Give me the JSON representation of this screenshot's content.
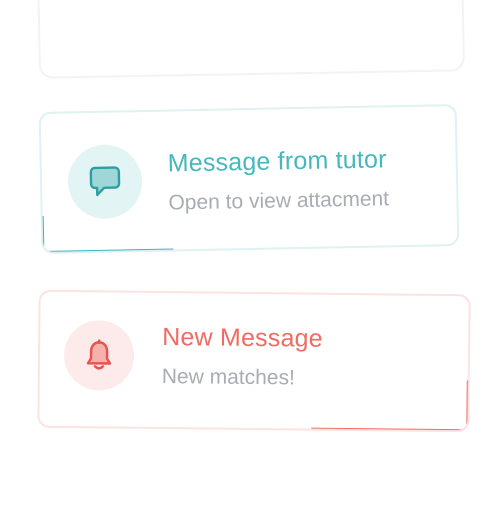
{
  "notifications": [
    {
      "id": "tutor",
      "title": "Message from tutor",
      "subtitle": "Open to view attacment",
      "icon": "chat-bubble-icon",
      "accent": "#3cb5b9"
    },
    {
      "id": "new",
      "title": "New Message",
      "subtitle": "New matches!",
      "icon": "bell-icon",
      "accent": "#f06b63"
    }
  ]
}
